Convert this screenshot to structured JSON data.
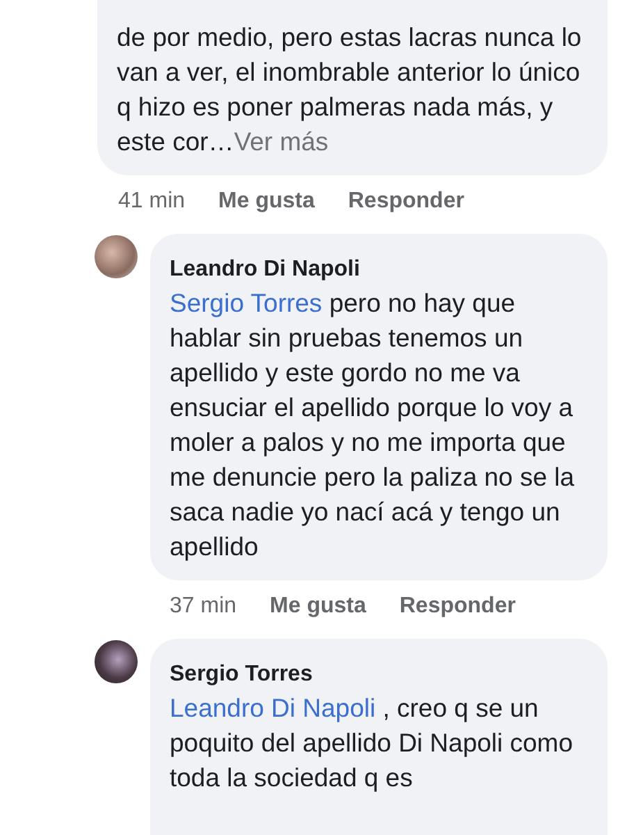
{
  "comments": [
    {
      "text": "de por medio, pero estas lacras nunca lo van a ver, el inombrable anterior lo único q hizo es poner palmeras nada más, y este cor…",
      "more": "Ver más",
      "time": "41 min",
      "like": "Me gusta",
      "reply": "Responder"
    },
    {
      "author": "Leandro Di Napoli",
      "mention": "Sergio Torres",
      "text": " pero no hay que hablar sin pruebas tenemos un apellido y este gordo no me va ensuciar el apellido porque lo voy a moler a palos y no me importa que me denuncie pero la paliza no se la saca nadie yo nací acá y tengo un apellido",
      "time": "37 min",
      "like": "Me gusta",
      "reply": "Responder"
    },
    {
      "author": "Sergio Torres",
      "mention": "Leandro Di Napoli",
      "text": " , creo q se un poquito del apellido Di Napoli como toda la sociedad q es"
    }
  ]
}
